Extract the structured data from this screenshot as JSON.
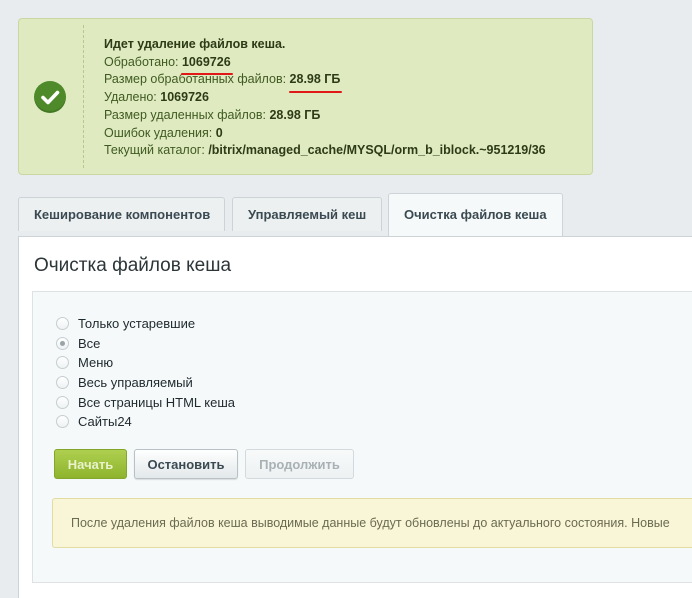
{
  "notice": {
    "title": "Идет удаление файлов кеша.",
    "processed_label": "Обработано:",
    "processed_value": "1069726",
    "processed_size_label": "Размер обработанных файлов:",
    "processed_size_value": "28.98 ГБ",
    "deleted_label": "Удалено:",
    "deleted_value": "1069726",
    "deleted_size_label": "Размер удаленных файлов:",
    "deleted_size_value": "28.98 ГБ",
    "errors_label": "Ошибок удаления:",
    "errors_value": "0",
    "current_dir_label": "Текущий каталог:",
    "current_dir_value": "/bitrix/managed_cache/MYSQL/orm_b_iblock.~951219/36",
    "icon": "check-circle-icon",
    "colors": {
      "background": "#dfeac0",
      "icon_bg": "#4e8a2a",
      "highlight_underline": "#e01818"
    }
  },
  "tabs": [
    {
      "label": "Кеширование компонентов",
      "active": false
    },
    {
      "label": "Управляемый кеш",
      "active": false
    },
    {
      "label": "Очистка файлов кеша",
      "active": true
    }
  ],
  "panel": {
    "title": "Очистка файлов кеша",
    "radio_options": [
      {
        "label": "Только устаревшие",
        "checked": false
      },
      {
        "label": "Все",
        "checked": true
      },
      {
        "label": "Меню",
        "checked": false
      },
      {
        "label": "Весь управляемый",
        "checked": false
      },
      {
        "label": "Все страницы HTML кеша",
        "checked": false
      },
      {
        "label": "Сайты24",
        "checked": false
      }
    ],
    "buttons": {
      "start": "Начать",
      "stop": "Остановить",
      "continue": "Продолжить"
    },
    "info_text": "После удаления файлов кеша выводимые данные будут обновлены до актуального состояния. Новые",
    "colors": {
      "start_button": "#9bc03a",
      "info_background": "#f9f6d7"
    }
  }
}
